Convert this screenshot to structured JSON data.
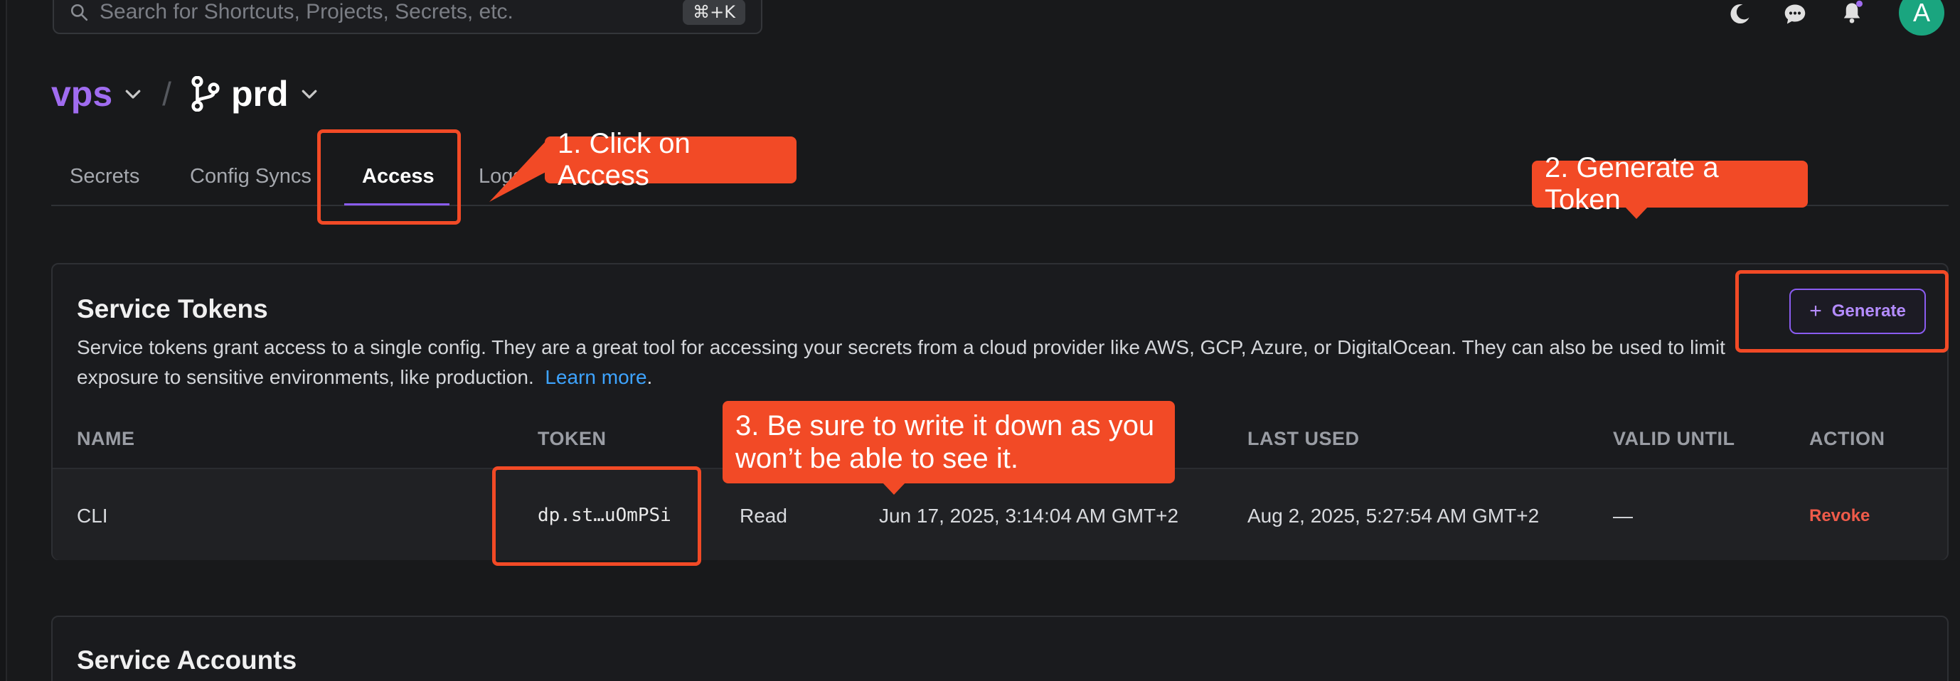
{
  "search": {
    "placeholder": "Search for Shortcuts, Projects, Secrets, etc.",
    "shortcut": "⌘+K"
  },
  "top_icons": [
    "moon-icon",
    "chat-icon",
    "bell-icon"
  ],
  "user": {
    "avatar_initial": "A",
    "avatar_color": "#1aa57f"
  },
  "breadcrumb": {
    "project": "vps",
    "separator": "/",
    "config": "prd"
  },
  "tabs": [
    {
      "label": "Secrets",
      "active": false
    },
    {
      "label": "Config Syncs",
      "active": false
    },
    {
      "label": "Access",
      "active": true
    },
    {
      "label": "Logs",
      "active": false
    }
  ],
  "service_tokens": {
    "title": "Service Tokens",
    "description": "Service tokens grant access to a single config. They are a great tool for accessing your secrets from a cloud provider like AWS, GCP, Azure, or DigitalOcean. They can also be used to limit exposure to sensitive environments, like production.",
    "learn_more": "Learn more",
    "generate_label": "Generate",
    "columns": [
      "NAME",
      "TOKEN",
      "LAST USED",
      "VALID UNTIL",
      "ACTION"
    ],
    "rows": [
      {
        "name": "CLI",
        "token": "dp.st…uOmPSi",
        "access": "Read",
        "created": "Jun 17, 2025, 3:14:04 AM GMT+2",
        "last_used": "Aug 2, 2025, 5:27:54 AM GMT+2",
        "valid_until": "—",
        "action": "Revoke"
      }
    ]
  },
  "service_accounts": {
    "title": "Service Accounts"
  },
  "annotations": {
    "step1": "1. Click on Access",
    "step2": "2. Generate a Token",
    "step3_line1": "3. Be sure to write it down as you",
    "step3_line2": "won’t be able to see it."
  },
  "colors": {
    "accent_purple": "#8a5cf0",
    "project_purple": "#a06cf0",
    "annotation_red": "#f24a26",
    "revoke_red": "#ef5b4a",
    "link_blue": "#3ea4ff"
  }
}
